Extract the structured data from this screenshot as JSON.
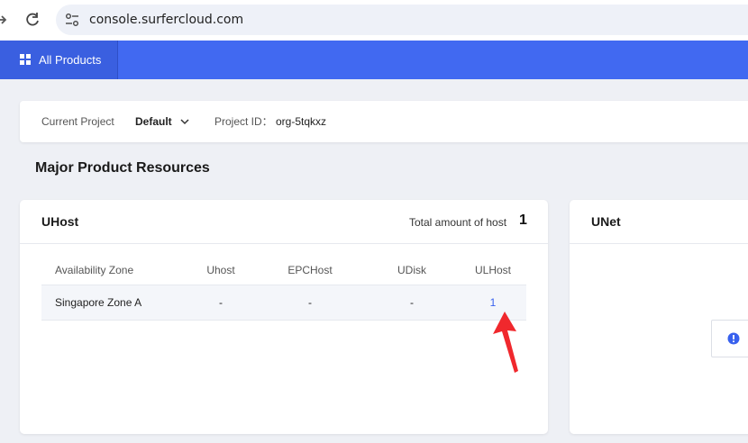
{
  "browser": {
    "url": "console.surfercloud.com"
  },
  "topnav": {
    "all_products": "All Products"
  },
  "project": {
    "current_label": "Current Project",
    "current_value": "Default",
    "id_label": "Project ID：",
    "id_value": "org-5tqkxz"
  },
  "section_title": "Major Product Resources",
  "uhost": {
    "title": "UHost",
    "total_label": "Total amount of host",
    "total_value": "1",
    "columns": [
      "Availability Zone",
      "Uhost",
      "EPCHost",
      "UDisk",
      "ULHost"
    ],
    "rows": [
      [
        "Singapore Zone A",
        "-",
        "-",
        "-",
        "1"
      ]
    ]
  },
  "unet": {
    "title": "UNet"
  },
  "colors": {
    "nav_blue": "#4169f1",
    "link_blue": "#3861ee",
    "annotation_arrow": "#f0282d"
  }
}
